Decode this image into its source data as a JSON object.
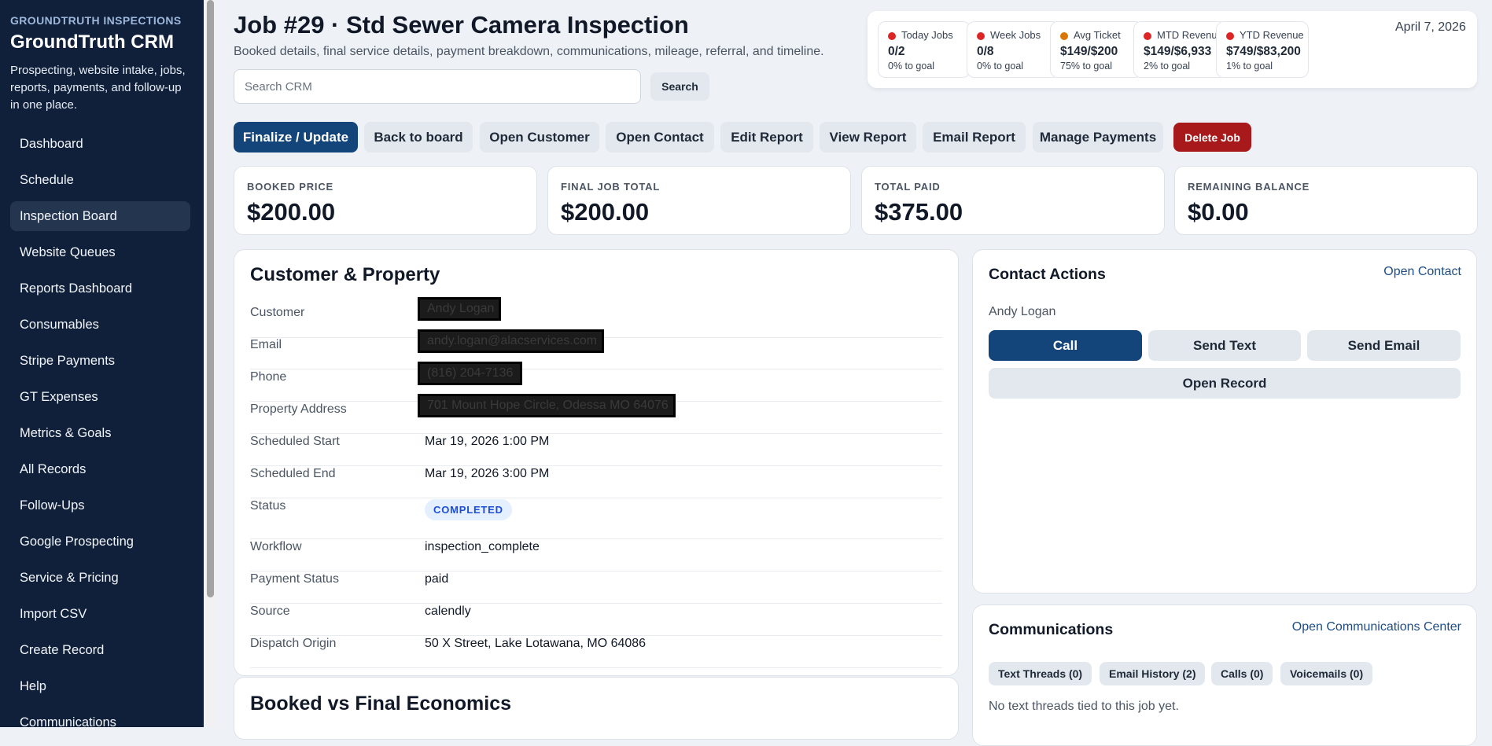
{
  "sidebar": {
    "brand_small": "GROUNDTRUTH INSPECTIONS",
    "brand_title": "GroundTruth CRM",
    "tagline": "Prospecting, website intake, jobs, reports, payments, and follow-up in one place.",
    "items": [
      {
        "label": "Dashboard"
      },
      {
        "label": "Schedule"
      },
      {
        "label": "Inspection Board",
        "active": true
      },
      {
        "label": "Website Queues"
      },
      {
        "label": "Reports Dashboard"
      },
      {
        "label": "Consumables"
      },
      {
        "label": "Stripe Payments"
      },
      {
        "label": "GT Expenses"
      },
      {
        "label": "Metrics & Goals"
      },
      {
        "label": "All Records"
      },
      {
        "label": "Follow-Ups"
      },
      {
        "label": "Google Prospecting"
      },
      {
        "label": "Service & Pricing"
      },
      {
        "label": "Import CSV"
      },
      {
        "label": "Create Record"
      },
      {
        "label": "Help"
      },
      {
        "label": "Communications"
      }
    ]
  },
  "header": {
    "title": "Job #29 · Std Sewer Camera Inspection",
    "subtitle": "Booked details, final service details, payment breakdown, communications, mileage, referral, and timeline.",
    "search_placeholder": "Search CRM",
    "search_button": "Search"
  },
  "metrics": {
    "date": "April 7, 2026",
    "cards": [
      {
        "label": "Today Jobs",
        "value": "0/2",
        "goal": "0% to goal",
        "color": "#dc2626"
      },
      {
        "label": "Week Jobs",
        "value": "0/8",
        "goal": "0% to goal",
        "color": "#dc2626"
      },
      {
        "label": "Avg Ticket",
        "value": "$149/$200",
        "goal": "75% to goal",
        "color": "#d97706"
      },
      {
        "label": "MTD Revenue",
        "value": "$149/$6,933",
        "goal": "2% to goal",
        "color": "#dc2626"
      },
      {
        "label": "YTD Revenue",
        "value": "$749/$83,200",
        "goal": "1% to goal",
        "color": "#dc2626"
      }
    ]
  },
  "actions": {
    "finalize": "Finalize / Update",
    "back": "Back to board",
    "open_customer": "Open Customer",
    "open_contact": "Open Contact",
    "edit_report": "Edit Report",
    "view_report": "View Report",
    "email_report": "Email Report",
    "manage_payments": "Manage Payments",
    "delete_job": "Delete Job"
  },
  "summary": [
    {
      "label": "BOOKED PRICE",
      "value": "$200.00"
    },
    {
      "label": "FINAL JOB TOTAL",
      "value": "$200.00"
    },
    {
      "label": "TOTAL PAID",
      "value": "$375.00"
    },
    {
      "label": "REMAINING BALANCE",
      "value": "$0.00"
    }
  ],
  "customer": {
    "title": "Customer & Property",
    "rows": [
      {
        "key": "Customer",
        "value": "Andy Logan",
        "redacted": true
      },
      {
        "key": "Email",
        "value": "andy.logan@alacservices.com",
        "redacted": true
      },
      {
        "key": "Phone",
        "value": "(816) 204-7136",
        "redacted": true
      },
      {
        "key": "Property Address",
        "value": "701 Mount Hope Circle, Odessa MO 64076",
        "redacted": true
      },
      {
        "key": "Scheduled Start",
        "value": "Mar 19, 2026 1:00 PM"
      },
      {
        "key": "Scheduled End",
        "value": "Mar 19, 2026 3:00 PM"
      },
      {
        "key": "Status",
        "value": "COMPLETED",
        "badge": true
      },
      {
        "key": "Workflow",
        "value": "inspection_complete"
      },
      {
        "key": "Payment Status",
        "value": "paid"
      },
      {
        "key": "Source",
        "value": "calendly"
      },
      {
        "key": "Dispatch Origin",
        "value": "50 X Street, Lake Lotawana, MO 64086"
      }
    ]
  },
  "economics": {
    "title": "Booked vs Final Economics"
  },
  "contact": {
    "title": "Contact Actions",
    "link": "Open Contact",
    "name": "Andy Logan",
    "call": "Call",
    "text": "Send Text",
    "email": "Send Email",
    "record": "Open Record"
  },
  "communications": {
    "title": "Communications",
    "link": "Open Communications Center",
    "tabs": [
      "Text Threads (0)",
      "Email History (2)",
      "Calls (0)",
      "Voicemails (0)"
    ],
    "empty": "No text threads tied to this job yet."
  }
}
